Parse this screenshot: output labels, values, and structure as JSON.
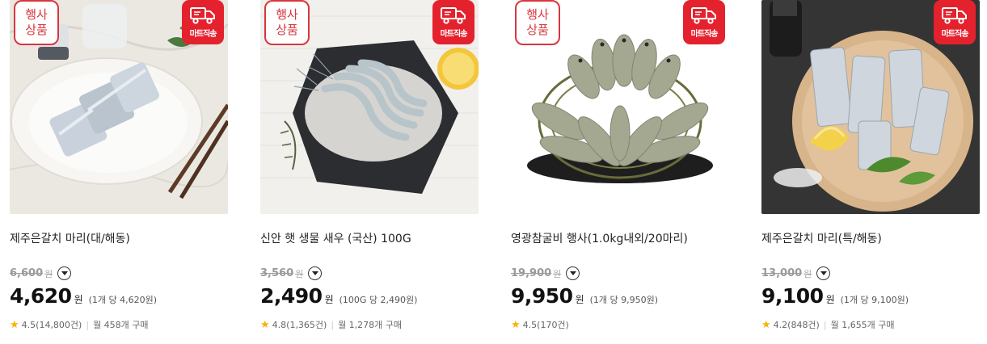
{
  "products": [
    {
      "event_tag": [
        "행사",
        "상품"
      ],
      "mart_tag": "마트직송",
      "name": "제주은갈치 마리(대/해동)",
      "original_price": "6,600",
      "original_unit": "원",
      "price": "4,620",
      "price_unit": "원",
      "unit_price": "(1개 당 4,620원)",
      "rating": "4.5(14,800건)",
      "monthly": "월 458개 구매",
      "image": "cutlassfish-plate",
      "image_colors": {
        "bg": "#ebe8e2",
        "main": "#c9d2dc",
        "accent": "#5c3a24"
      }
    },
    {
      "event_tag": [
        "행사",
        "상품"
      ],
      "mart_tag": "마트직송",
      "name": "신안 햇 생물 새우 (국산) 100G",
      "original_price": "3,560",
      "original_unit": "원",
      "price": "2,490",
      "price_unit": "원",
      "unit_price": "(100G 당 2,490원)",
      "rating": "4.8(1,365건)",
      "monthly": "월 1,278개 구매",
      "image": "shrimp-slate",
      "image_colors": {
        "bg": "#f1f0ed",
        "main": "#2b2d31",
        "accent": "#f3c63b"
      }
    },
    {
      "event_tag": [
        "행사",
        "상품"
      ],
      "mart_tag": "마트직송",
      "name": "영광참굴비 행사(1.0kg내외/20마리)",
      "original_price": "19,900",
      "original_unit": "원",
      "price": "9,950",
      "price_unit": "원",
      "unit_price": "(1개 당 9,950원)",
      "rating": "4.5(170건)",
      "monthly": "",
      "image": "yellow-croaker-bundle",
      "image_colors": {
        "bg": "#ffffff",
        "main": "#a4a891",
        "accent": "#6a6b3a"
      }
    },
    {
      "event_tag": [],
      "mart_tag": "마트직송",
      "name": "제주은갈치 마리(특/해동)",
      "original_price": "13,000",
      "original_unit": "원",
      "price": "9,100",
      "price_unit": "원",
      "unit_price": "(1개 당 9,100원)",
      "rating": "4.2(848건)",
      "monthly": "월 1,655개 구매",
      "image": "cutlassfish-board",
      "image_colors": {
        "bg": "#343434",
        "main": "#d8b48a",
        "accent": "#4d8a2e"
      }
    }
  ]
}
